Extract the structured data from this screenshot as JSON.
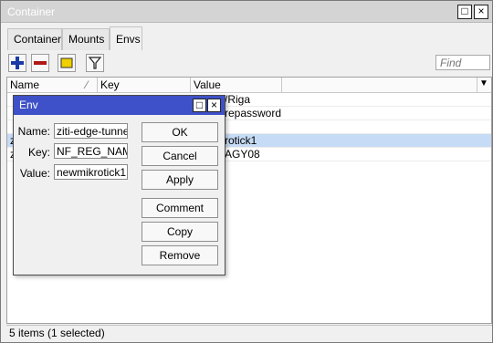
{
  "window": {
    "title": "Container",
    "controls": {
      "maximize": "□",
      "close": "×"
    }
  },
  "tabs": [
    {
      "label": "Container"
    },
    {
      "label": "Mounts"
    },
    {
      "label": "Envs",
      "active": true
    }
  ],
  "toolbar": {
    "add_icon": "plus-icon",
    "remove_icon": "minus-icon",
    "comment_icon": "comment-icon",
    "filter_icon": "filter-icon",
    "find_placeholder": "Find"
  },
  "table": {
    "columns": [
      "Name",
      "Key",
      "Value"
    ],
    "rows": [
      {
        "name": "",
        "key": "",
        "value": "/Riga"
      },
      {
        "name": "",
        "key": "",
        "value": "repassword"
      },
      {
        "name": "",
        "key": "",
        "value": ""
      },
      {
        "name": "z",
        "key": "",
        "value": "rotick1",
        "selected": true
      },
      {
        "name": "z",
        "key": "",
        "value": "AGY08"
      }
    ]
  },
  "status_text": "5 items (1 selected)",
  "dialog": {
    "title": "Env",
    "controls": {
      "maximize": "□",
      "close": "×"
    },
    "fields": {
      "name_label": "Name:",
      "name_value": "ziti-edge-tunnel",
      "key_label": "Key:",
      "key_value": "NF_REG_NAMI",
      "value_label": "Value:",
      "value_value": "newmikrotick1"
    },
    "buttons": {
      "ok": "OK",
      "cancel": "Cancel",
      "apply": "Apply",
      "comment": "Comment",
      "copy": "Copy",
      "remove": "Remove"
    }
  },
  "colors": {
    "dialog_titlebar": "#3f51c8",
    "selected_row": "#c6dbf5",
    "add_icon": "#1a3aa8",
    "remove_icon": "#b01818",
    "comment_icon": "#f0d000"
  }
}
